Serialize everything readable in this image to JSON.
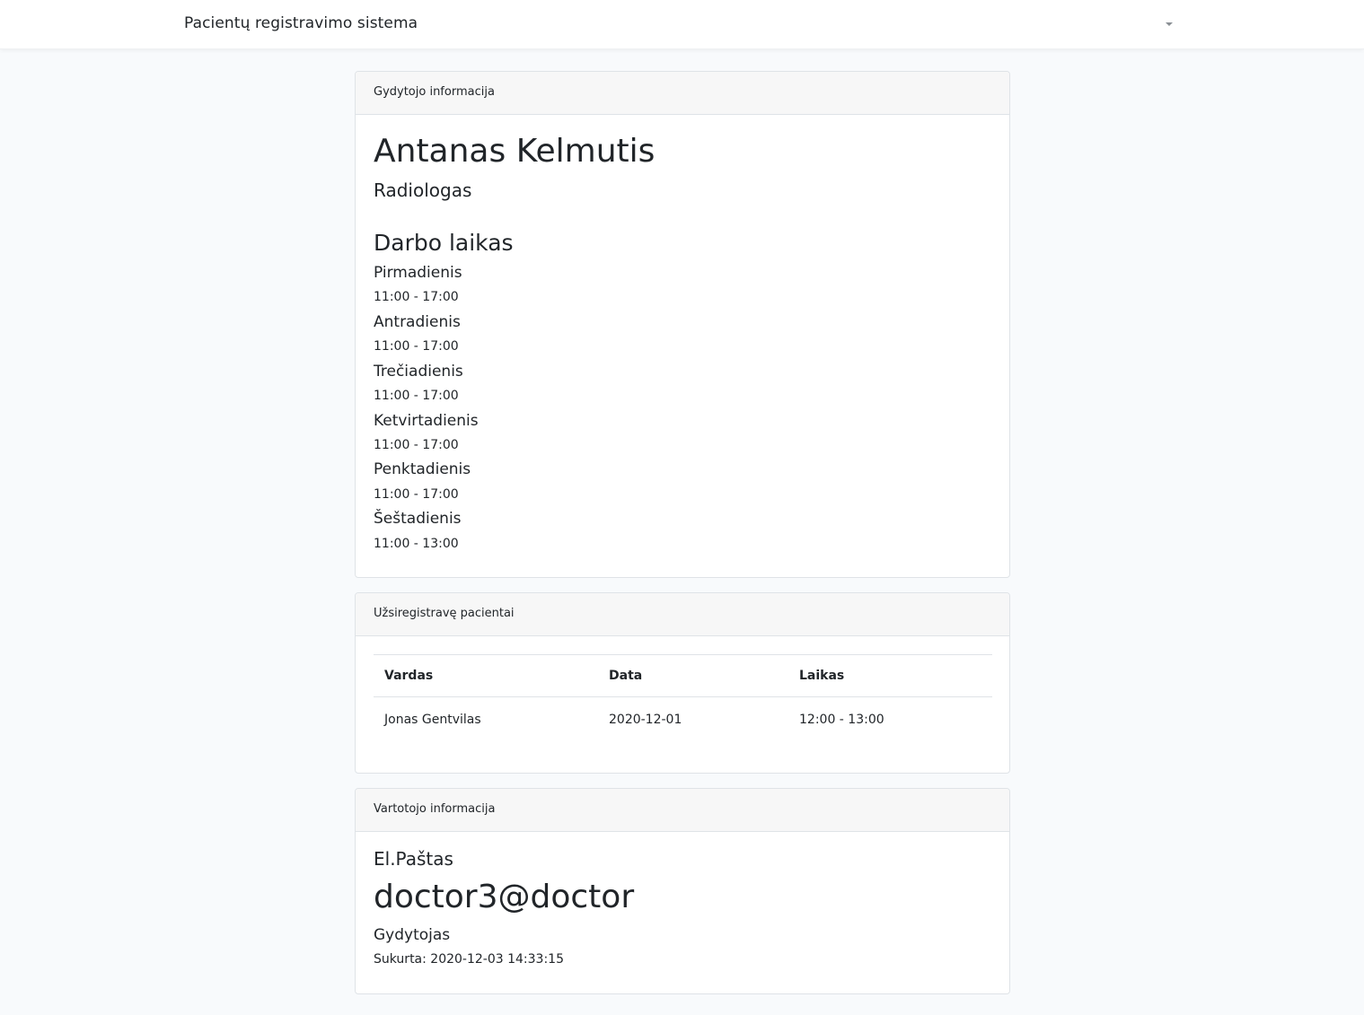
{
  "navbar": {
    "brand": "Pacientų registravimo sistema",
    "user_menu_icon": "caret-down-icon"
  },
  "doctor_card": {
    "header": "Gydytojo informacija",
    "name": "Antanas Kelmutis",
    "specialty": "Radiologas",
    "schedule_title": "Darbo laikas",
    "schedule": [
      {
        "day": "Pirmadienis",
        "time": "11:00 - 17:00"
      },
      {
        "day": "Antradienis",
        "time": "11:00 - 17:00"
      },
      {
        "day": "Trečiadienis",
        "time": "11:00 - 17:00"
      },
      {
        "day": "Ketvirtadienis",
        "time": "11:00 - 17:00"
      },
      {
        "day": "Penktadienis",
        "time": "11:00 - 17:00"
      },
      {
        "day": "Šeštadienis",
        "time": "11:00 - 13:00"
      }
    ]
  },
  "patients_card": {
    "header": "Užsiregistravę pacientai",
    "columns": [
      "Vardas",
      "Data",
      "Laikas"
    ],
    "rows": [
      {
        "name": "Jonas Gentvilas",
        "date": "2020-12-01",
        "time": "12:00 - 13:00"
      }
    ]
  },
  "user_card": {
    "header": "Vartotojo informacija",
    "email_label": "El.Paštas",
    "email": "doctor3@doctor",
    "role": "Gydytojas",
    "created": "Sukurta: 2020-12-03 14:33:15"
  }
}
